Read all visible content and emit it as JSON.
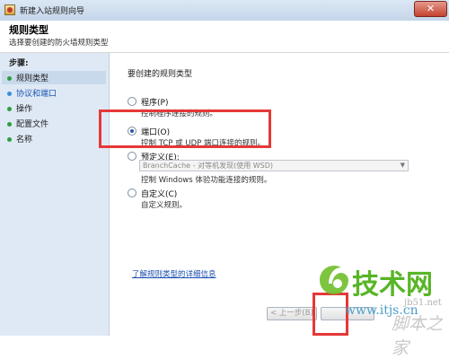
{
  "window": {
    "title": "新建入站规则向导"
  },
  "header": {
    "title": "规则类型",
    "subtitle": "选择要创建的防火墙规则类型"
  },
  "steps": {
    "label": "步骤:",
    "items": [
      {
        "label": "规则类型"
      },
      {
        "label": "协议和端口"
      },
      {
        "label": "操作"
      },
      {
        "label": "配置文件"
      },
      {
        "label": "名称"
      }
    ]
  },
  "main": {
    "question": "要创建的规则类型",
    "options": [
      {
        "label": "程序(P)",
        "desc": "控制程序连接的规则。",
        "checked": false
      },
      {
        "label": "端口(O)",
        "desc": "控制 TCP 或 UDP 端口连接的规则。",
        "checked": true
      },
      {
        "label": "预定义(E):",
        "desc": "控制 Windows 体验功能连接的规则。",
        "checked": false
      },
      {
        "label": "自定义(C)",
        "desc": "自定义规则。",
        "checked": false
      }
    ],
    "predefined_select": "BranchCache - 对等机发现(使用 WSD)",
    "help_link": "了解规则类型的详细信息"
  },
  "buttons": {
    "back": "< 上一步(B)"
  },
  "watermark": {
    "line1": "技术网",
    "line2": "www.itjs.cn",
    "line3": "jb51.net",
    "line4": "脚本之家"
  },
  "colors": {
    "highlight": "#e53838",
    "sidebar": "#dfe9f5",
    "link": "#1a4fb0"
  }
}
